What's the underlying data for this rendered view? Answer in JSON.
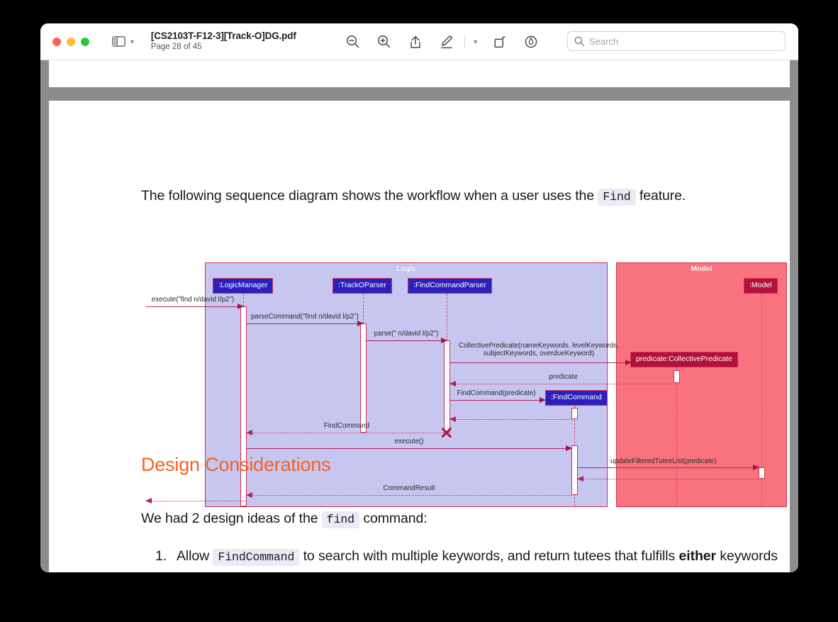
{
  "window": {
    "traffic_lights": [
      "close",
      "minimize",
      "maximize"
    ],
    "sidebar_label": "sidebar-toggle",
    "document_title": "[CS2103T-F12-3][Track-O]DG.pdf",
    "page_indicator": "Page 28 of 45",
    "tools": [
      {
        "name": "zoom-out-icon",
        "label": "Zoom Out"
      },
      {
        "name": "zoom-in-icon",
        "label": "Zoom In"
      },
      {
        "name": "share-icon",
        "label": "Share"
      },
      {
        "name": "markup-pen-icon",
        "label": "Markup"
      },
      {
        "name": "chevron-down-icon",
        "label": "Markup Options"
      },
      {
        "name": "rotate-icon",
        "label": "Rotate"
      },
      {
        "name": "annotate-icon",
        "label": "Annotate"
      }
    ],
    "search": {
      "placeholder": "Search"
    }
  },
  "document": {
    "intro_before": "The following sequence diagram shows the workflow when a user uses the",
    "intro_code": "Find",
    "intro_after": "feature.",
    "heading": "Design Considerations",
    "subpara_before": "We had 2 design ideas of the",
    "subpara_code": "find",
    "subpara_after": "command:",
    "list": [
      {
        "num": "1.",
        "before": "Allow",
        "code": "FindCommand",
        "middle": "to search with multiple keywords, and return tutees that fulfills",
        "bold": "either",
        "after": "keywords"
      }
    ]
  },
  "chart_data": {
    "type": "sequence-diagram",
    "title": "Find feature sequence diagram",
    "frames": [
      {
        "name": "Logic",
        "color": "#c7c6f1",
        "border": "#cc3355"
      },
      {
        "name": "Model",
        "color": "#f9737f",
        "border": "#cc3355"
      }
    ],
    "participants": [
      {
        "id": "logicmanager",
        "label": ":LogicManager",
        "frame": "Logic",
        "style": "blue"
      },
      {
        "id": "trackoparser",
        "label": ":TrackOParser",
        "frame": "Logic",
        "style": "blue"
      },
      {
        "id": "findcommandparser",
        "label": ":FindCommandParser",
        "frame": "Logic",
        "style": "blue"
      },
      {
        "id": "findcommand",
        "label": ":FindCommand",
        "frame": "Logic",
        "style": "blue"
      },
      {
        "id": "model",
        "label": ":Model",
        "frame": "Model",
        "style": "dark"
      },
      {
        "id": "collectivepredicate",
        "label": "predicate:CollectivePredicate",
        "frame": "Model",
        "style": "dark"
      }
    ],
    "messages": [
      {
        "seq": 1,
        "label": "execute(\"find n/david l/p2\")",
        "from": "actor",
        "to": "logicmanager",
        "kind": "call"
      },
      {
        "seq": 2,
        "label": "parseCommand(\"find n/david l/p2\")",
        "from": "logicmanager",
        "to": "trackoparser",
        "kind": "call"
      },
      {
        "seq": 3,
        "label": "parse(\" n/david l/p2\")",
        "from": "trackoparser",
        "to": "findcommandparser",
        "kind": "call"
      },
      {
        "seq": 4,
        "label": "CollectivePredicate(nameKeywords, levelKeywords,\nsubjectKeywords, overdueKeyword)",
        "from": "findcommandparser",
        "to": "collectivepredicate",
        "kind": "call"
      },
      {
        "seq": 5,
        "label": "predicate",
        "from": "collectivepredicate",
        "to": "findcommandparser",
        "kind": "return"
      },
      {
        "seq": 6,
        "label": "FindCommand(predicate)",
        "from": "findcommandparser",
        "to": "findcommand",
        "kind": "call"
      },
      {
        "seq": 7,
        "label": "",
        "from": "findcommand",
        "to": "findcommandparser",
        "kind": "return"
      },
      {
        "seq": 8,
        "label": "FindCommand",
        "from": "findcommandparser",
        "to": "logicmanager",
        "kind": "return"
      },
      {
        "seq": 9,
        "label": "execute()",
        "from": "logicmanager",
        "to": "findcommand",
        "kind": "call"
      },
      {
        "seq": 10,
        "label": "updateFilteredTuteeList(predicate)",
        "from": "findcommand",
        "to": "model",
        "kind": "call"
      },
      {
        "seq": 11,
        "label": "",
        "from": "model",
        "to": "findcommand",
        "kind": "return"
      },
      {
        "seq": 12,
        "label": "CommandResult",
        "from": "findcommand",
        "to": "logicmanager",
        "kind": "return"
      },
      {
        "seq": 13,
        "label": "",
        "from": "logicmanager",
        "to": "actor",
        "kind": "return"
      }
    ],
    "destroyed": [
      "findcommandparser"
    ]
  }
}
